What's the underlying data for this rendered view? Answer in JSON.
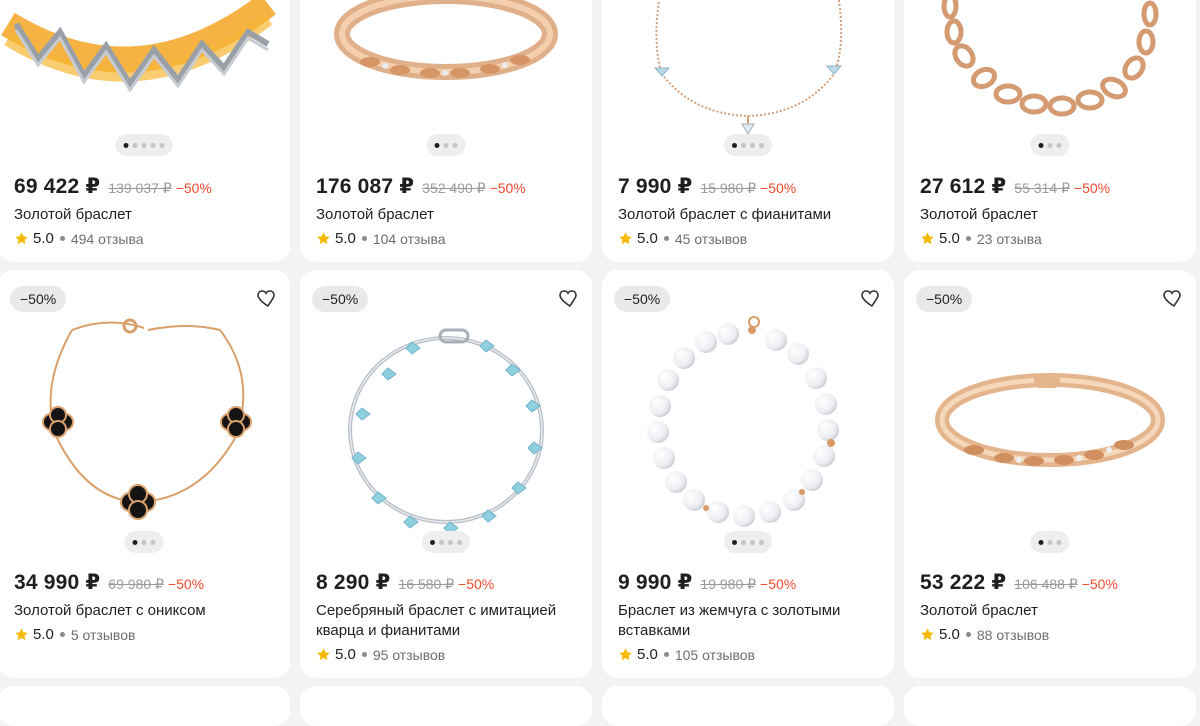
{
  "colors": {
    "discount": "#f04a2f",
    "star": "#f6b800",
    "gold": "#d9a06b",
    "background": "#f2f3f5"
  },
  "products": [
    {
      "price": "69 422 ₽",
      "old_price": "139 037 ₽",
      "discount": "−50%",
      "title": "Золотой браслет",
      "rating": "5.0",
      "reviews": "494 отзыва",
      "image_icon": "gold-silver-zigzag-bracelet",
      "slides": 5,
      "active_slide": 1
    },
    {
      "price": "176 087 ₽",
      "old_price": "352 490 ₽",
      "discount": "−50%",
      "title": "Золотой браслет",
      "rating": "5.0",
      "reviews": "104 отзыва",
      "image_icon": "gold-leaf-bangle",
      "slides": 3,
      "active_slide": 1
    },
    {
      "price": "7 990 ₽",
      "old_price": "15 980 ₽",
      "discount": "−50%",
      "title": "Золотой браслет с фианитами",
      "rating": "5.0",
      "reviews": "45 отзывов",
      "image_icon": "gold-chain-crystal-charms",
      "slides": 4,
      "active_slide": 1
    },
    {
      "price": "27 612 ₽",
      "old_price": "55 314 ₽",
      "discount": "−50%",
      "title": "Золотой браслет",
      "rating": "5.0",
      "reviews": "23 отзыва",
      "image_icon": "gold-oval-link-chain",
      "slides": 3,
      "active_slide": 1
    },
    {
      "badge": "−50%",
      "price": "34 990 ₽",
      "old_price": "69 980 ₽",
      "discount": "−50%",
      "title": "Золотой браслет с ониксом",
      "rating": "5.0",
      "reviews": "5 отзывов",
      "image_icon": "gold-onyx-clover-bracelet",
      "slides": 3,
      "active_slide": 1
    },
    {
      "badge": "−50%",
      "price": "8 290 ₽",
      "old_price": "16 580 ₽",
      "discount": "−50%",
      "title": "Серебряный браслет с имитацией кварца и фианитами",
      "rating": "5.0",
      "reviews": "95 отзывов",
      "image_icon": "silver-blue-quartz-bracelet",
      "slides": 4,
      "active_slide": 1
    },
    {
      "badge": "−50%",
      "price": "9 990 ₽",
      "old_price": "19 980 ₽",
      "discount": "−50%",
      "title": "Браслет из жемчуга с золотыми вставками",
      "rating": "5.0",
      "reviews": "105 отзывов",
      "image_icon": "pearl-gold-bracelet",
      "slides": 4,
      "active_slide": 1
    },
    {
      "badge": "−50%",
      "price": "53 222 ₽",
      "old_price": "106 488 ₽",
      "discount": "−50%",
      "title": "Золотой браслет",
      "rating": "5.0",
      "reviews": "88 отзывов",
      "image_icon": "gold-leaf-bangle-angled",
      "slides": 3,
      "active_slide": 1
    }
  ]
}
